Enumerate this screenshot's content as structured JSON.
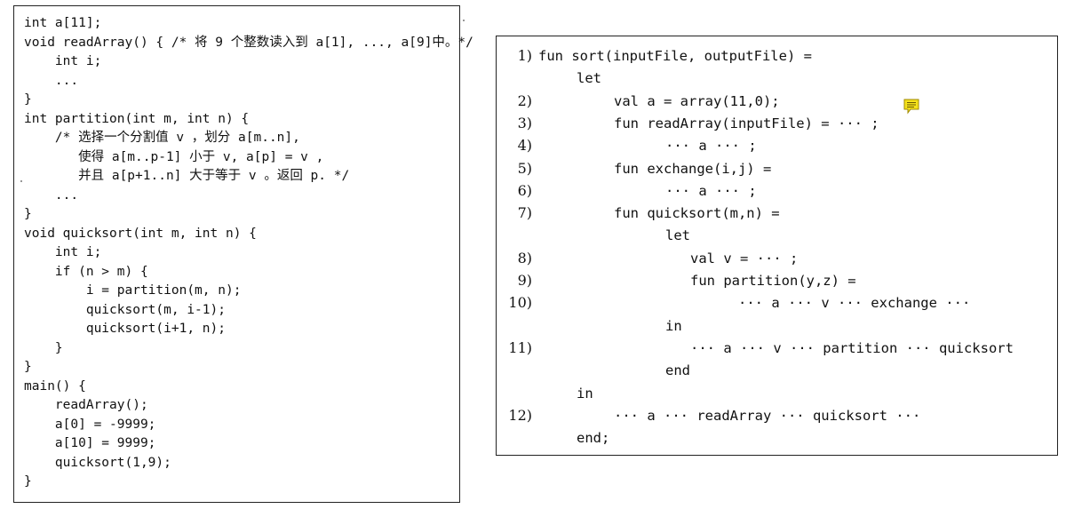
{
  "left_code": [
    "int a[11];",
    "void readArray() { /* 将 9 个整数读入到 a[1], ..., a[9]中。*/",
    "    int i;",
    "    ...",
    "}",
    "int partition(int m, int n) {",
    "    /* 选择一个分割值 v ，划分 a[m..n],",
    "       使得 a[m..p-1] 小于 v, a[p] = v ,",
    "       并且 a[p+1..n] 大于等于 v 。返回 p. */",
    "    ...",
    "}",
    "void quicksort(int m, int n) {",
    "    int i;",
    "    if (n > m) {",
    "        i = partition(m, n);",
    "        quicksort(m, i-1);",
    "        quicksort(i+1, n);",
    "    }",
    "}",
    "main() {",
    "    readArray();",
    "    a[0] = -9999;",
    "    a[10] = 9999;",
    "    quicksort(1,9);",
    "}"
  ],
  "right_lines": [
    {
      "num": "1)",
      "code": "fun sort(inputFile, outputFile) =",
      "indent": 0
    },
    {
      "num": "",
      "code": "let",
      "indent": 1
    },
    {
      "num": "2)",
      "code": "val a = array(11,0);",
      "indent": 2
    },
    {
      "num": "3)",
      "code": "fun readArray(inputFile) = ··· ;",
      "indent": 2
    },
    {
      "num": "4)",
      "code": "··· a ··· ;",
      "indent": 3
    },
    {
      "num": "5)",
      "code": "fun exchange(i,j) =",
      "indent": 2
    },
    {
      "num": "6)",
      "code": "··· a ··· ;",
      "indent": 3
    },
    {
      "num": "7)",
      "code": "fun quicksort(m,n) =",
      "indent": 2
    },
    {
      "num": "",
      "code": "let",
      "indent": 3
    },
    {
      "num": "8)",
      "code": "val v = ··· ;",
      "indent": 4
    },
    {
      "num": "9)",
      "code": "fun partition(y,z) =",
      "indent": 4
    },
    {
      "num": "10)",
      "code": "··· a ··· v ··· exchange ···",
      "indent": 5
    },
    {
      "num": "",
      "code": "in",
      "indent": 3
    },
    {
      "num": "11)",
      "code": "··· a ··· v ··· partition ··· quicksort",
      "indent": 4
    },
    {
      "num": "",
      "code": "end",
      "indent": 3
    },
    {
      "num": "",
      "code": "in",
      "indent": 1
    },
    {
      "num": "12)",
      "code": "··· a ··· readArray ··· quicksort ···",
      "indent": 2
    },
    {
      "num": "",
      "code": "end;",
      "indent": 1
    }
  ],
  "note_icon": {
    "name": "comment-note-icon",
    "color": "#f5e21b"
  }
}
